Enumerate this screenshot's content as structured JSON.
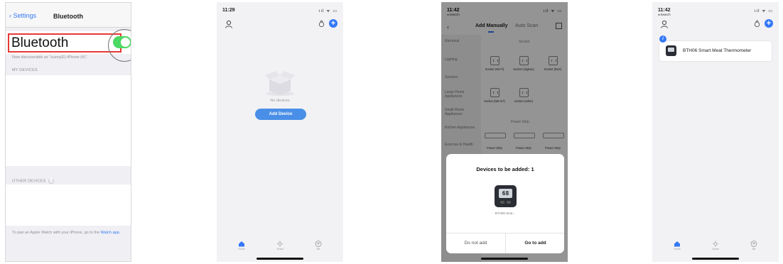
{
  "screen1": {
    "back_label": "Settings",
    "title": "Bluetooth",
    "bluetooth_label": "Bluetooth",
    "toggle_on": true,
    "discoverable_text": "Now discoverable as \"suzxy(E)-iPhone (4)\".",
    "my_devices_header": "MY DEVICES",
    "other_devices_header": "OTHER DEVICES",
    "footnote_text": "To pair an Apple Watch with your iPhone, go to the",
    "footnote_link": "Watch app."
  },
  "screen2": {
    "time": "11:29",
    "status_icons": "ııl ᯤ ▭",
    "empty_label": "No devices",
    "add_button": "Add Device",
    "tabs": [
      "Home",
      "Smart",
      "Me"
    ]
  },
  "screen3": {
    "time": "11:42",
    "search_back": "◂ Search",
    "tab_manual": "Add Manually",
    "tab_auto": "Auto Scan",
    "categories": [
      "Electrical",
      "Lighting",
      "Sensors",
      "Large Home Appliances",
      "Small Home Appliances",
      "Kitchen Appliances",
      "Exercise & Health"
    ],
    "section_socket": "Socket",
    "section_power_strip": "Power Strip",
    "devices": [
      "Socket (Wi-Fi)",
      "Socket (Zigbee)",
      "Socket (BLE)",
      "Socket (NB-IoT)",
      "Socket (other)"
    ],
    "strips": [
      "Power Strip",
      "Power Strip",
      "Power Strip"
    ],
    "modal_title": "Devices to be added: 1",
    "device_display": "68",
    "device_name": "BTH06 Sma...",
    "btn_cancel": "Do not add",
    "btn_confirm": "Go to add"
  },
  "screen4": {
    "time": "11:42",
    "search_back": "◂ Search",
    "badge": "i",
    "device_name": "BTH06 Smart Meat Thermometer",
    "tabs": [
      "Home",
      "Smart",
      "Me"
    ]
  },
  "colors": {
    "ios_blue": "#3478f6",
    "toggle_green": "#4cd964",
    "highlight_red": "#e53935"
  }
}
